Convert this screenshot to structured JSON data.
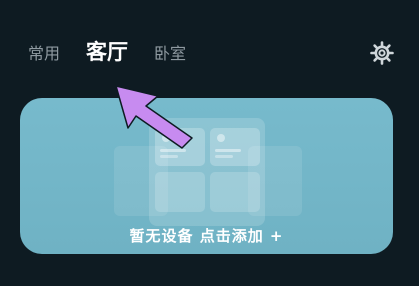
{
  "tabs": [
    {
      "label": "常用",
      "active": false
    },
    {
      "label": "客厅",
      "active": true
    },
    {
      "label": "卧室",
      "active": false
    }
  ],
  "header": {
    "settings_icon": "gear-icon"
  },
  "empty_state": {
    "message": "暂无设备 点击添加 +"
  },
  "colors": {
    "background": "#0e1b22",
    "card": "#77bacc",
    "arrow": "#c78bf0"
  }
}
